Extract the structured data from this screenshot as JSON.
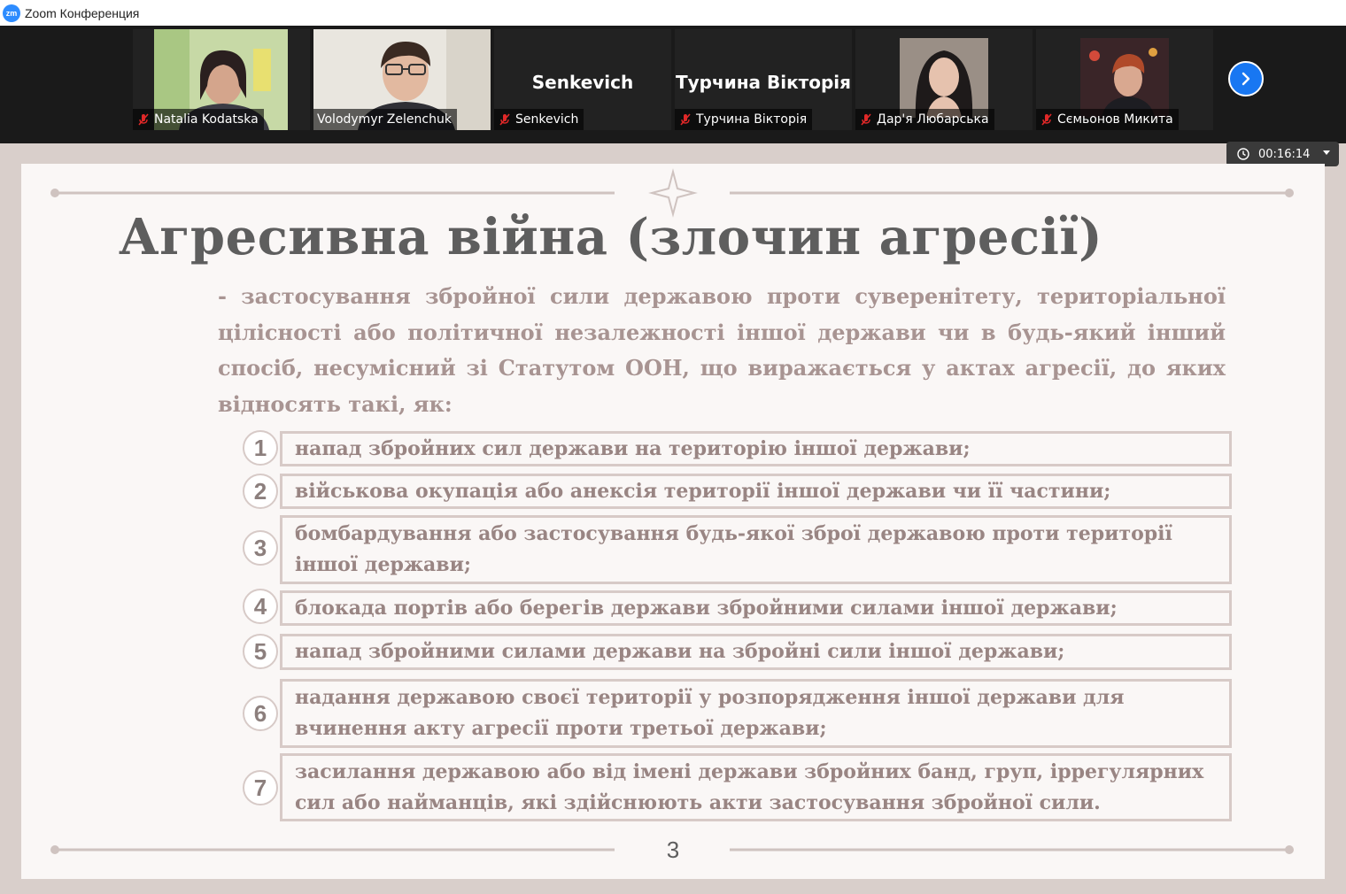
{
  "window": {
    "title": "Zoom Конференция",
    "logo_text": "zm"
  },
  "participants": [
    {
      "name": "Natalia Kodatska",
      "muted": true,
      "has_video": true,
      "active": false
    },
    {
      "name": "Volodymyr Zelenchuk",
      "muted": false,
      "has_video": true,
      "active": true
    },
    {
      "name": "Senkevich",
      "display": "Senkevich",
      "muted": true,
      "has_video": false,
      "active": false
    },
    {
      "name": "Турчина Вікторія",
      "display": "Турчина Вікторія",
      "muted": true,
      "has_video": false,
      "active": false
    },
    {
      "name": "Дар'я Любарська",
      "muted": true,
      "has_video": true,
      "active": false
    },
    {
      "name": "Сємьонов Микита",
      "muted": true,
      "has_video": true,
      "active": false
    }
  ],
  "timer": {
    "elapsed": "00:16:14"
  },
  "slide": {
    "title": "Агресивна війна (злочин агресії)",
    "definition": "- застосування збройної сили державою проти суверенітету, територіальної цілісності або політичної незалежності іншої держави чи в будь-який інший спосіб, несумісний зі Статутом ООН, що виражається у актах агресії, до яких відносять такі, як:",
    "items": [
      {
        "num": "1",
        "text": "напад збройних сил держави на територію іншої держави;"
      },
      {
        "num": "2",
        "text": "військова окупація або анексія території іншої держави чи її частини;"
      },
      {
        "num": "3",
        "text": "бомбардування або застосування будь-якої зброї державою проти території іншої держави;"
      },
      {
        "num": "4",
        "text": "блокада портів або берегів держави збройними силами іншої держави;"
      },
      {
        "num": "5",
        "text": "напад збройними силами держави на збройні сили іншої держави;"
      },
      {
        "num": "6",
        "text": "надання державою своєї території у розпорядження іншої держави для вчинення акту агресії проти третьої держави;"
      },
      {
        "num": "7",
        "text": "засилання державою або від імені держави збройних банд, груп, іррегулярних сил або найманців, які здійснюють акти застосування збройної сили."
      }
    ],
    "page_number": "3"
  },
  "colors": {
    "slide_bg": "#faf7f6",
    "title": "#5e5e5e",
    "text": "#a89492",
    "border": "#d7cac7",
    "accent": "#1877f2",
    "speaker": "#b9d97a"
  }
}
